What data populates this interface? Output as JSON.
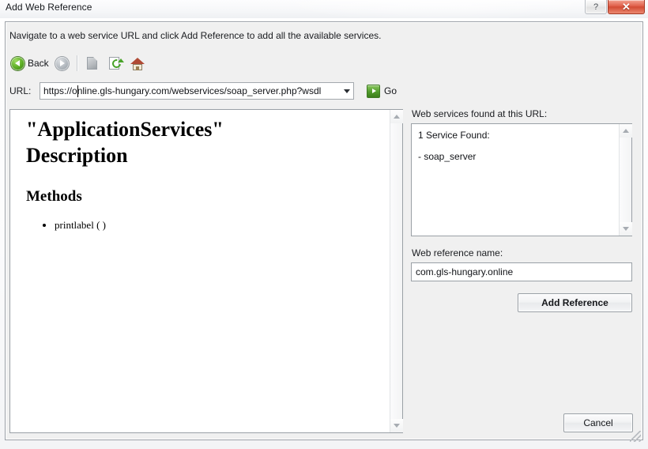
{
  "window": {
    "title": "Add Web Reference",
    "help_label": "?",
    "close_label": "✕"
  },
  "instruction": "Navigate to a web service URL and click Add Reference to add all the available services.",
  "toolbar": {
    "back_label": "Back",
    "forward_label": "",
    "stop_label": "",
    "refresh_label": "",
    "home_label": ""
  },
  "url_bar": {
    "label": "URL:",
    "value": "https://online.gls-hungary.com/webservices/soap_server.php?wsdl",
    "placeholder": "",
    "go_label": "Go"
  },
  "browser": {
    "heading": "\"ApplicationServices\" Description",
    "section": "Methods",
    "methods": [
      "printlabel ( )"
    ]
  },
  "services": {
    "label": "Web services found at this URL:",
    "count_line": "1 Service Found:",
    "items": [
      "- soap_server"
    ]
  },
  "reference": {
    "label": "Web reference name:",
    "value": "com.gls-hungary.online",
    "placeholder": ""
  },
  "buttons": {
    "add_reference": "Add Reference",
    "cancel": "Cancel"
  },
  "colors": {
    "accent_green": "#4f9b2a",
    "close_red": "#d24b33",
    "dialog_bg": "#f0f0f0",
    "field_bg": "#ffffff",
    "border": "#9aa0a6"
  }
}
